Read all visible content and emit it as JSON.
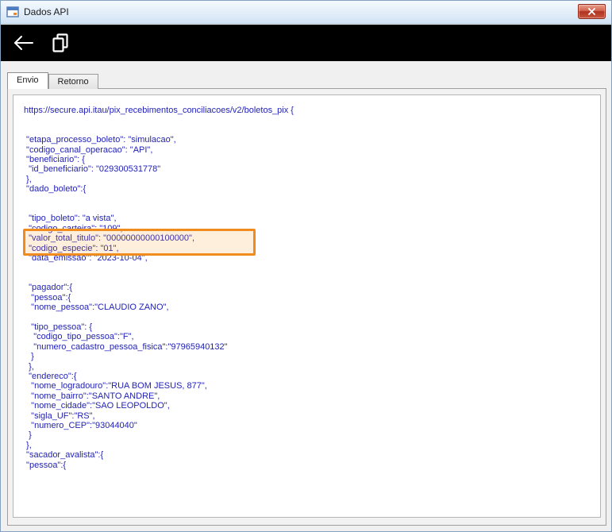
{
  "window": {
    "title": "Dados API"
  },
  "toolbar": {
    "back_icon": "back-arrow",
    "copy_icon": "copy-pages"
  },
  "tabs": [
    {
      "label": "Envio",
      "active": true
    },
    {
      "label": "Retorno",
      "active": false
    }
  ],
  "envio": {
    "request_body": "https://secure.api.itau/pix_recebimentos_conciliacoes/v2/boletos_pix {\n\n\n \"etapa_processo_boleto\": \"simulacao\",\n \"codigo_canal_operacao\": \"API\",\n \"beneficiario\": {\n  \"id_beneficiario\": \"029300531778\"\n },\n \"dado_boleto\":{\n\n\n  \"tipo_boleto\": \"a vista\",\n  \"codigo_carteira\": \"109\",\n  \"valor_total_titulo\": \"00000000000100000\",\n  \"codigo_especie\": \"01\",\n  \"data_emissao\": \"2023-10-04\",\n\n\n  \"pagador\":{\n   \"pessoa\":{\n   \"nome_pessoa\":\"CLAUDIO ZANO\",\n\n   \"tipo_pessoa\": {\n    \"codigo_tipo_pessoa\":\"F\",\n    \"numero_cadastro_pessoa_fisica\":\"97965940132\"\n   }\n  },\n  \"endereco\":{\n   \"nome_logradouro\":\"RUA BOM JESUS, 877\",\n   \"nome_bairro\":\"SANTO ANDRE\",\n   \"nome_cidade\":\"SAO LEOPOLDO\",\n   \"sigla_UF\":\"RS\",\n   \"numero_CEP\":\"93044040\"\n  }\n },\n \"sacador_avalista\":{\n \"pessoa\":{"
  },
  "annotation": {
    "color": "#F08C1E",
    "highlighted_field": "valor_total_titulo"
  }
}
